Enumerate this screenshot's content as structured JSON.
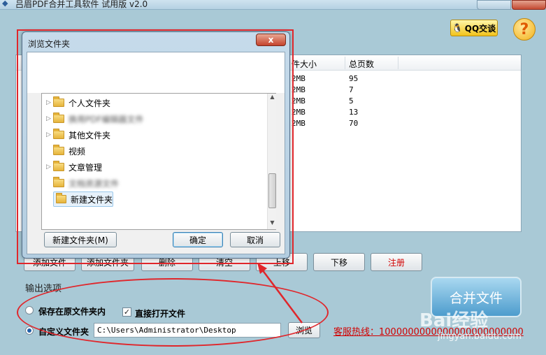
{
  "window": {
    "title": "吕眉PDF合并工具软件 试用版 v2.0",
    "qq_label": "QQ交谈",
    "help_label": "?"
  },
  "file_list": {
    "columns": [
      "件大小",
      "总页数"
    ],
    "rows": [
      {
        "size": "2MB",
        "pages": "95"
      },
      {
        "size": "2MB",
        "pages": "7"
      },
      {
        "size": "2MB",
        "pages": "5"
      },
      {
        "size": "2MB",
        "pages": "13"
      },
      {
        "size": "2MB",
        "pages": "70"
      }
    ]
  },
  "buttons": {
    "add_file": "添加文件",
    "add_folder": "添加文件夹",
    "delete": "删除",
    "clear": "清空",
    "move_up": "上移",
    "move_down": "下移",
    "register": "注册",
    "merge": "合并文件",
    "browse": "浏览"
  },
  "output": {
    "label": "输出选项",
    "keep_original_folder": "保存在原文件夹内",
    "open_directly": "直接打开文件",
    "custom_folder": "自定义文件夹",
    "path": "C:\\Users\\Administrator\\Desktop",
    "custom_selected": true,
    "open_directly_checked": true
  },
  "contact": {
    "text": "客服热线：1000000000000000000000000"
  },
  "watermark": {
    "logo": "Bai经验",
    "url": "jingyan.baidu.com"
  },
  "dialog": {
    "title": "浏览文件夹",
    "close": "x",
    "tree": [
      {
        "label": "个人文件夹",
        "has_arrow": true,
        "blurred": false
      },
      {
        "label": "换用PDF编辑器文件",
        "has_arrow": true,
        "blurred": true
      },
      {
        "label": "其他文件夹",
        "has_arrow": true,
        "blurred": false
      },
      {
        "label": "视频",
        "has_arrow": false,
        "blurred": false
      },
      {
        "label": "文章管理",
        "has_arrow": true,
        "blurred": false
      },
      {
        "label": "文档资源文件",
        "has_arrow": false,
        "blurred": true
      },
      {
        "label": "新建文件夹",
        "has_arrow": false,
        "blurred": false,
        "selected": true
      }
    ],
    "new_folder": "新建文件夹(M)",
    "ok": "确定",
    "cancel": "取消"
  },
  "colors": {
    "annotation": "#e0262b",
    "background": "#a9c9d6",
    "register_text": "#d20000"
  }
}
